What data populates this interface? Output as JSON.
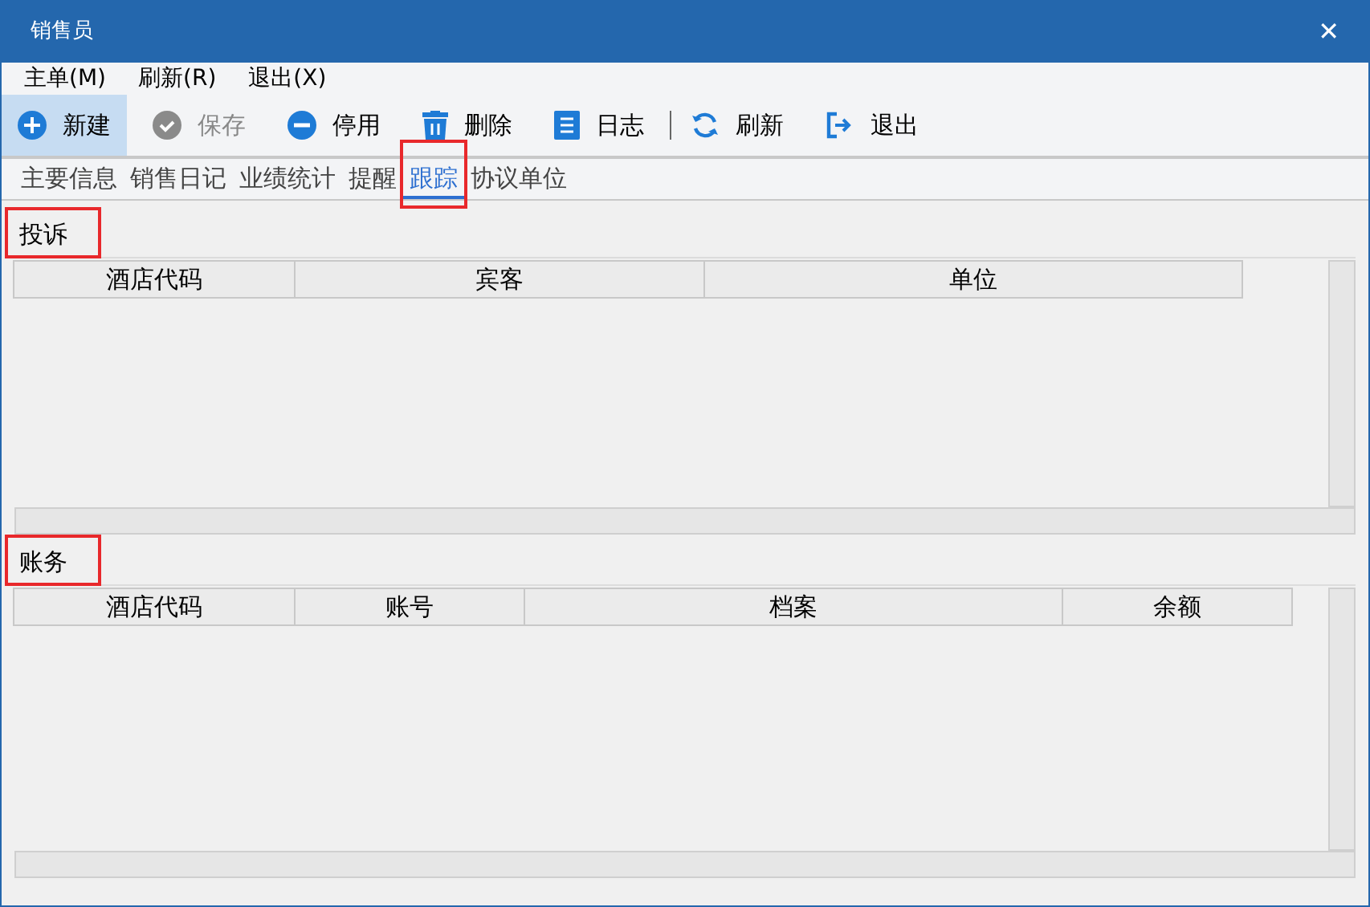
{
  "window": {
    "title": "销售员",
    "close": "✕"
  },
  "menu": [
    "主单(M)",
    "刷新(R)",
    "退出(X)"
  ],
  "toolbar": [
    {
      "kind": "add",
      "label": "新建",
      "selected": true,
      "disabled": false
    },
    {
      "kind": "save",
      "label": "保存",
      "selected": false,
      "disabled": true
    },
    {
      "kind": "stop",
      "label": "停用",
      "selected": false,
      "disabled": false
    },
    {
      "kind": "delete",
      "label": "删除",
      "selected": false,
      "disabled": false
    },
    {
      "kind": "log",
      "label": "日志",
      "selected": false,
      "disabled": false
    },
    {
      "kind": "refresh",
      "label": "刷新",
      "selected": false,
      "disabled": false
    },
    {
      "kind": "exit",
      "label": "退出",
      "selected": false,
      "disabled": false
    }
  ],
  "tabs": [
    {
      "label": "主要信息",
      "selected": false,
      "highlighted": false
    },
    {
      "label": "销售日记",
      "selected": false,
      "highlighted": false
    },
    {
      "label": "业绩统计",
      "selected": false,
      "highlighted": false
    },
    {
      "label": "提醒",
      "selected": false,
      "highlighted": false
    },
    {
      "label": "跟踪",
      "selected": true,
      "highlighted": true
    },
    {
      "label": "协议单位",
      "selected": false,
      "highlighted": false
    }
  ],
  "sections": [
    {
      "title": "投诉",
      "highlighted": true,
      "columns": [
        "酒店代码",
        "宾客",
        "单位"
      ]
    },
    {
      "title": "账务",
      "highlighted": true,
      "columns": [
        "酒店代码",
        "账号",
        "档案",
        "余额"
      ]
    }
  ]
}
